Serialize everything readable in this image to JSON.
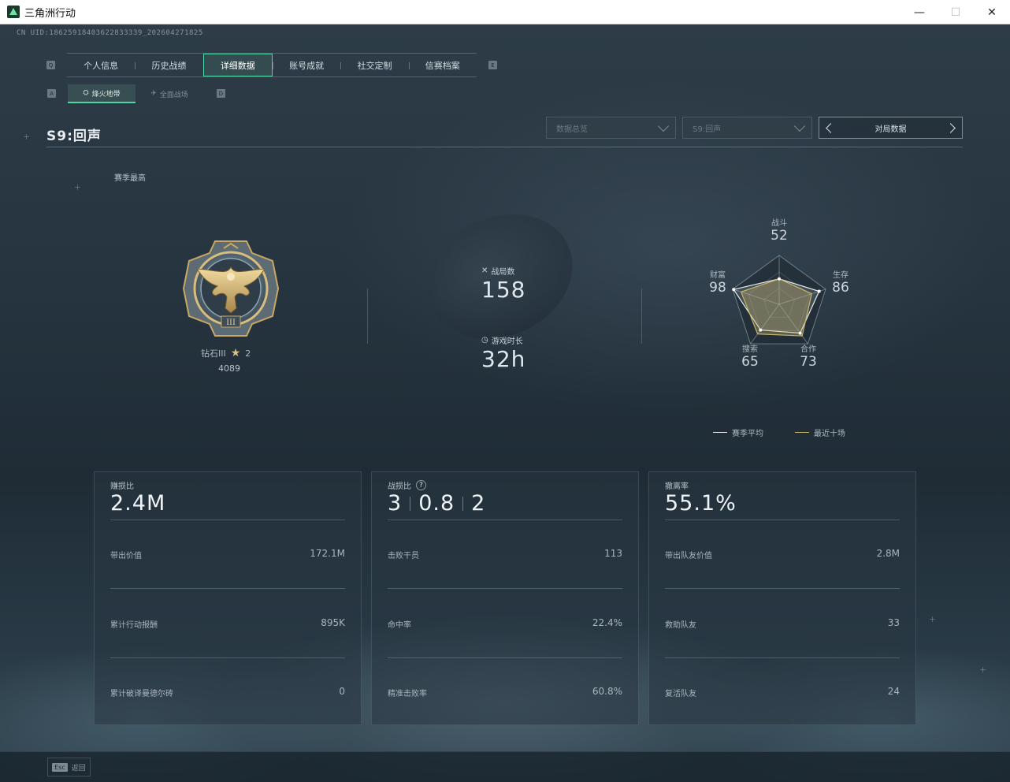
{
  "window": {
    "title": "三角洲行动",
    "minimize": "—",
    "maximize": "☐",
    "close": "✕"
  },
  "uid": "CN UID:18625918403622833339_202604271825",
  "tabs": [
    {
      "label": "个人信息"
    },
    {
      "label": "历史战绩"
    },
    {
      "label": "详细数据",
      "active": true
    },
    {
      "label": "账号成就"
    },
    {
      "label": "社交定制"
    },
    {
      "label": "信赛档案"
    }
  ],
  "tab_keys": {
    "left": "Q",
    "right": "E"
  },
  "subtabs": [
    {
      "label": "烽火地带",
      "active": true
    },
    {
      "label": "全面战场"
    }
  ],
  "subtab_keys": {
    "left": "A",
    "right": "D"
  },
  "season_title": "S9:回声",
  "dropdowns": {
    "data_type": "数据总览",
    "season": "S9:回声"
  },
  "pager": {
    "label": "对局数据"
  },
  "season_best": "赛季最高",
  "rank": {
    "name": "钻石III",
    "stars": "2",
    "score": "4089"
  },
  "matches": {
    "label": "战局数",
    "value": "158"
  },
  "playtime": {
    "label": "游戏时长",
    "value": "32h"
  },
  "radar": {
    "axes": [
      {
        "label": "战斗",
        "value": "52",
        "season_avg": 52,
        "recent": 52
      },
      {
        "label": "生存",
        "value": "86",
        "season_avg": 86,
        "recent": 70
      },
      {
        "label": "合作",
        "value": "73",
        "season_avg": 73,
        "recent": 80
      },
      {
        "label": "搜索",
        "value": "65",
        "season_avg": 65,
        "recent": 75
      },
      {
        "label": "财富",
        "value": "98",
        "season_avg": 98,
        "recent": 82
      }
    ],
    "legend": {
      "season_avg": "赛季平均",
      "recent": "最近十场"
    },
    "colors": {
      "season_avg": "#e6ecef",
      "recent": "#c9b46a"
    }
  },
  "cards": [
    {
      "title": "赚损比",
      "value": "2.4M",
      "rows": [
        {
          "label": "带出价值",
          "value": "172.1M"
        },
        {
          "label": "累计行动报酬",
          "value": "895K"
        },
        {
          "label": "累计破译曼德尔砖",
          "value": "0"
        }
      ]
    },
    {
      "title": "战损比",
      "help": "?",
      "kda": [
        "3",
        "0.8",
        "2"
      ],
      "rows": [
        {
          "label": "击败干员",
          "value": "113"
        },
        {
          "label": "命中率",
          "value": "22.4%"
        },
        {
          "label": "精准击败率",
          "value": "60.8%"
        }
      ]
    },
    {
      "title": "撤离率",
      "value": "55.1%",
      "rows": [
        {
          "label": "带出队友价值",
          "value": "2.8M"
        },
        {
          "label": "救助队友",
          "value": "33"
        },
        {
          "label": "复活队友",
          "value": "24"
        }
      ]
    }
  ],
  "footer": {
    "esc_key": "Esc",
    "back_label": "返回"
  }
}
